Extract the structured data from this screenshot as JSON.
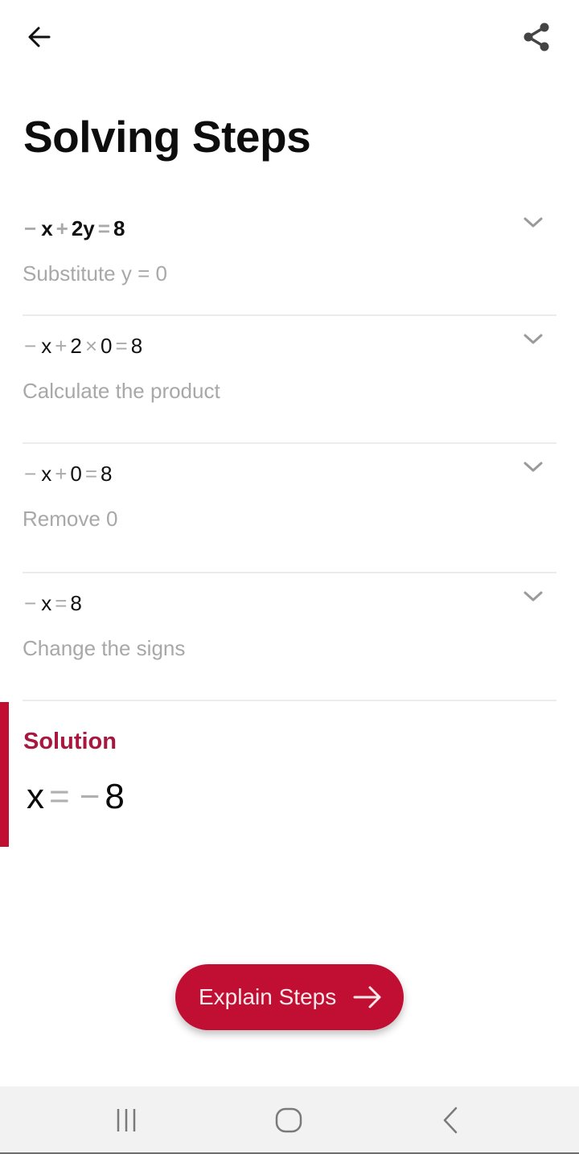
{
  "header": {
    "back_icon": "arrow-left-icon",
    "share_icon": "share-icon",
    "title": "Solving Steps"
  },
  "steps": [
    {
      "expression_tokens": [
        {
          "t": "−",
          "op": true
        },
        {
          "t": "x",
          "op": false
        },
        {
          "t": "+",
          "op": true
        },
        {
          "t": "2y",
          "op": false
        },
        {
          "t": "=",
          "op": true
        },
        {
          "t": "8",
          "op": false
        }
      ],
      "description": "Substitute y = 0",
      "expand_icon": "chevron-down-icon"
    },
    {
      "expression_tokens": [
        {
          "t": "−",
          "op": true
        },
        {
          "t": "x",
          "op": false
        },
        {
          "t": "+",
          "op": true
        },
        {
          "t": "2",
          "op": false
        },
        {
          "t": "×",
          "op": true
        },
        {
          "t": "0",
          "op": false
        },
        {
          "t": "=",
          "op": true
        },
        {
          "t": "8",
          "op": false
        }
      ],
      "description": "Calculate the product",
      "expand_icon": "chevron-down-icon"
    },
    {
      "expression_tokens": [
        {
          "t": "−",
          "op": true
        },
        {
          "t": "x",
          "op": false
        },
        {
          "t": "+",
          "op": true
        },
        {
          "t": "0",
          "op": false
        },
        {
          "t": "=",
          "op": true
        },
        {
          "t": "8",
          "op": false
        }
      ],
      "description": "Remove 0",
      "expand_icon": "chevron-down-icon"
    },
    {
      "expression_tokens": [
        {
          "t": "−",
          "op": true
        },
        {
          "t": "x",
          "op": false
        },
        {
          "t": "=",
          "op": true
        },
        {
          "t": "8",
          "op": false
        }
      ],
      "description": "Change the signs",
      "expand_icon": "chevron-down-icon"
    }
  ],
  "solution": {
    "label": "Solution",
    "expression_tokens": [
      {
        "t": "x",
        "op": false
      },
      {
        "t": "=",
        "op": true
      },
      {
        "t": "−",
        "op": true
      },
      {
        "t": "8",
        "op": false
      }
    ]
  },
  "explain_button": {
    "label": "Explain Steps",
    "icon": "arrow-right-icon"
  },
  "system_nav": {
    "recent_apps": "recent-apps-icon",
    "home": "home-icon",
    "back": "back-icon"
  },
  "colors": {
    "accent": "#c10f33",
    "solution_label": "#a8173d",
    "operator_gray": "#aaaaaa",
    "description_gray": "#a8a8a8"
  }
}
